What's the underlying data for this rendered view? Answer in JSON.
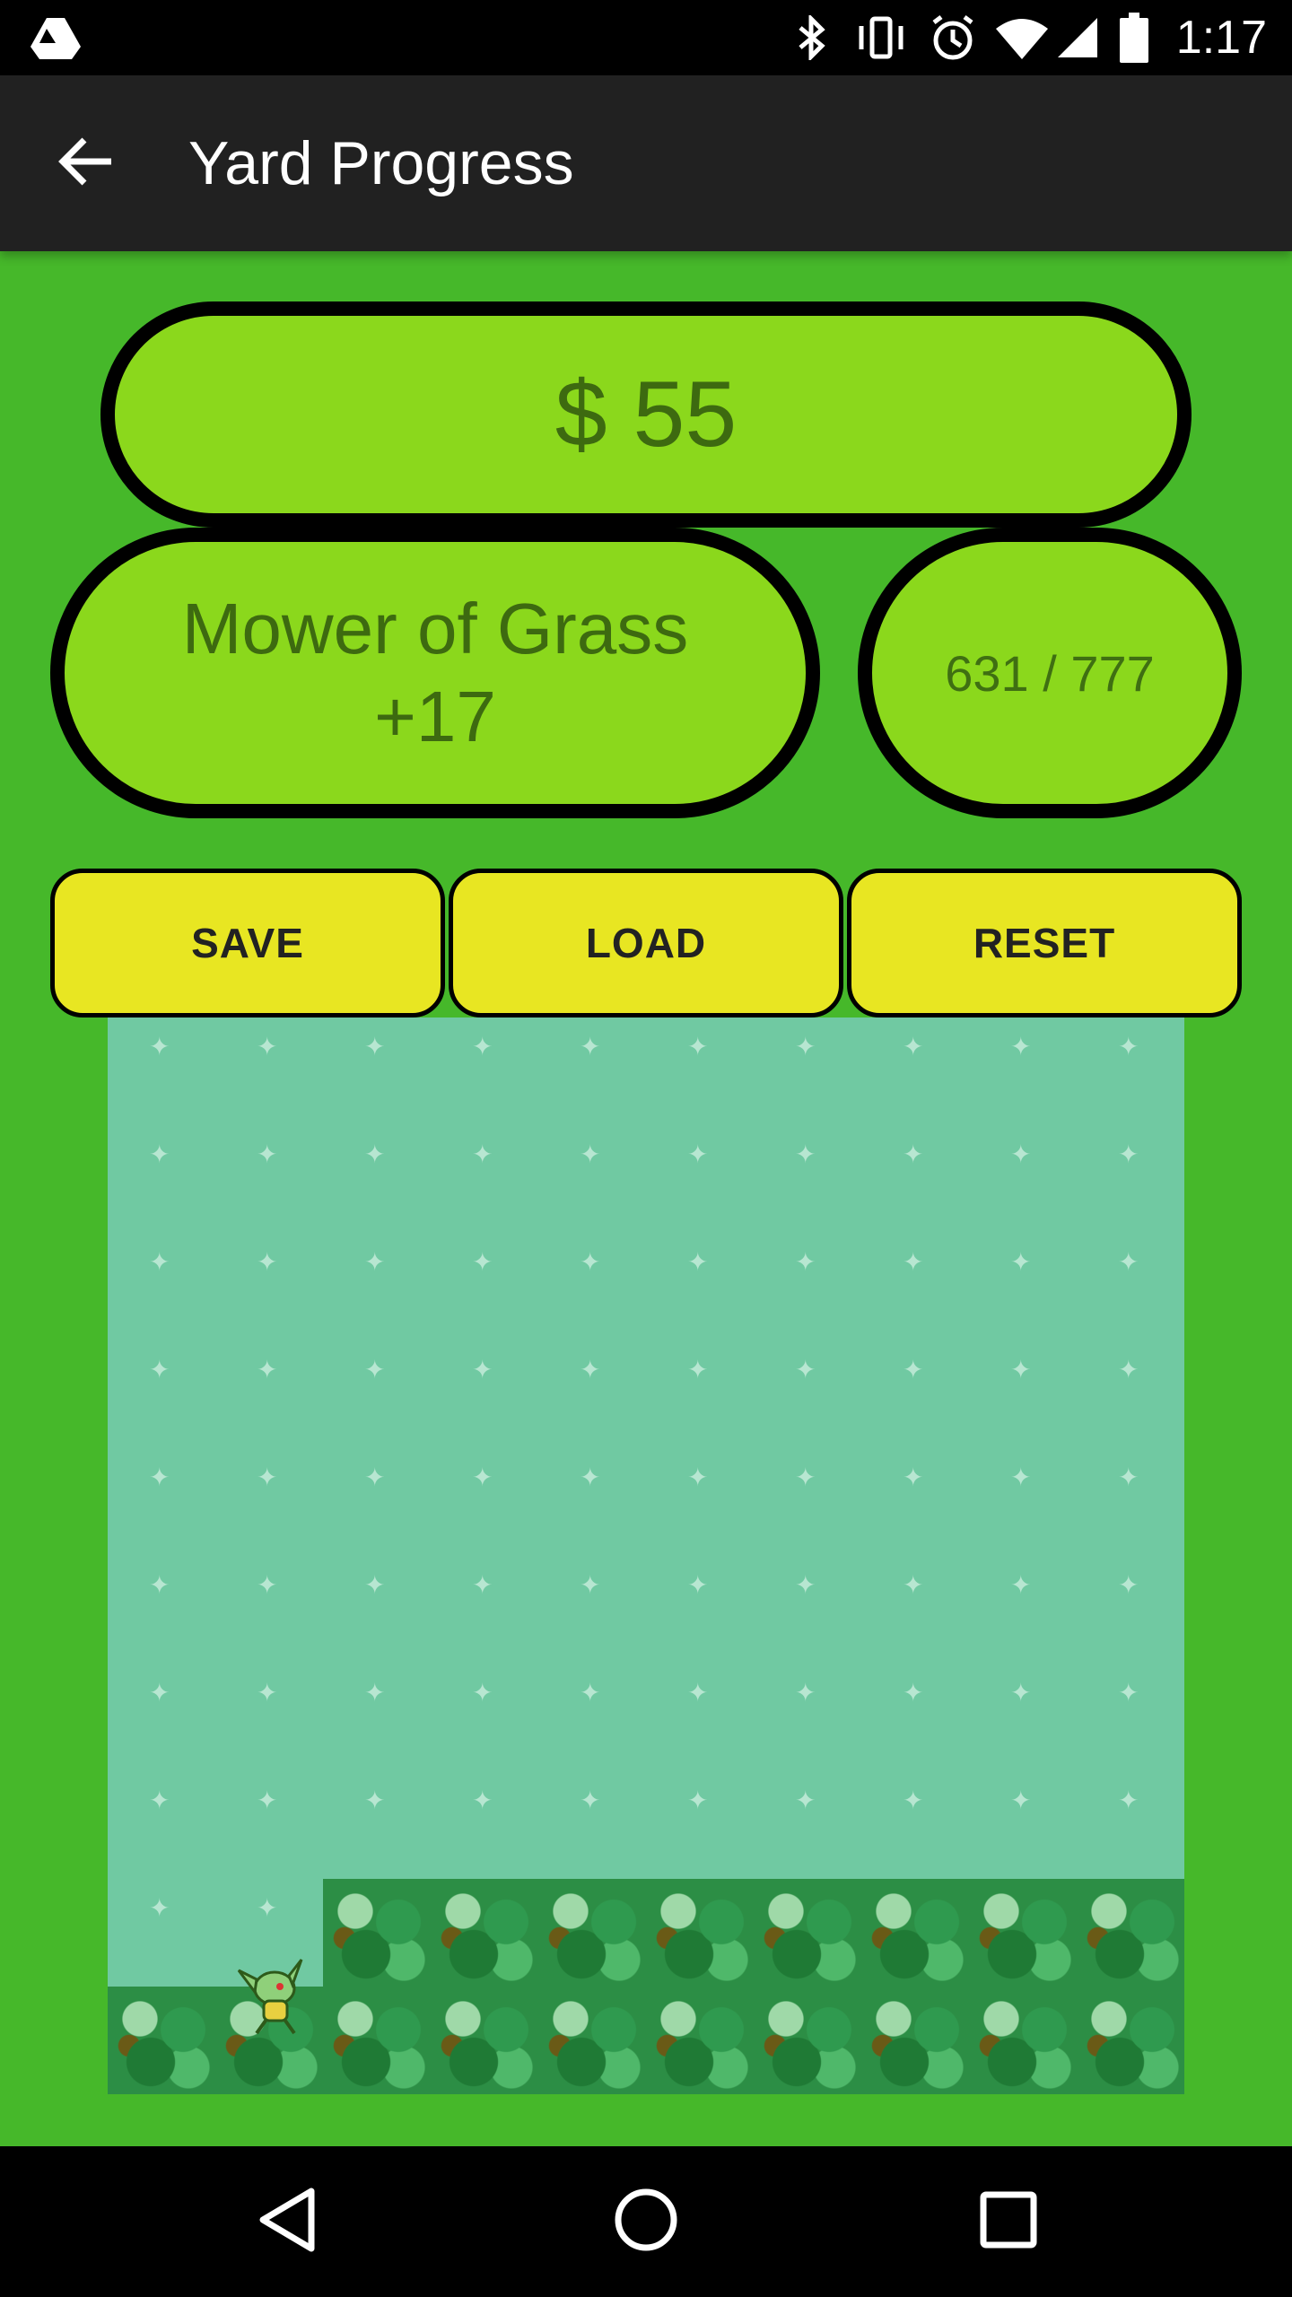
{
  "status_bar": {
    "time": "1:17",
    "icons": [
      "drive-icon",
      "bluetooth-icon",
      "vibrate-icon",
      "alarm-icon",
      "wifi-icon",
      "signal-icon",
      "battery-icon"
    ]
  },
  "app_bar": {
    "title": "Yard Progress",
    "back_icon": "arrow-back-icon"
  },
  "stats": {
    "money": "$ 55",
    "mower_title": "Mower of Grass",
    "mower_bonus": "+17",
    "progress_text": "631 / 777"
  },
  "actions": {
    "save": "SAVE",
    "load": "LOAD",
    "reset": "RESET"
  },
  "yard": {
    "grid": [
      10,
      10
    ],
    "uncut_bush_rows": 2,
    "mower_position": {
      "row": 9,
      "col": 1
    }
  },
  "nav_bar": {
    "icons": [
      "back-triangle-icon",
      "home-circle-icon",
      "recents-square-icon"
    ]
  },
  "colors": {
    "background": "#46b82a",
    "pill": "#8bd81c",
    "pill_text": "#3d6a10",
    "button": "#e8e622",
    "cut_grass": "#70c9a2",
    "bush": "#2c8e45",
    "app_bar": "#212121"
  }
}
